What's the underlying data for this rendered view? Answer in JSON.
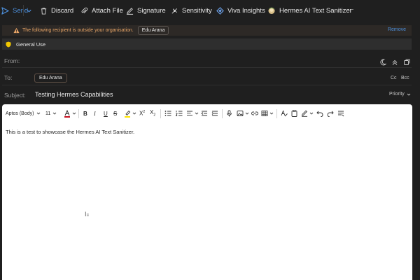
{
  "toolbar": {
    "send_label": "Send",
    "discard_label": "Discard",
    "attach_label": "Attach File",
    "signature_label": "Signature",
    "sensitivity_label": "Sensitivity",
    "viva_label": "Viva Insights",
    "hermes_label": "Hermes AI Text Sanitizer",
    "more_label": "···"
  },
  "warning": {
    "text": "The following recipient is outside your organisation.",
    "recipient": "Edu Arana",
    "remove_label": "Remove"
  },
  "sensitivity_banner": {
    "label": "General Use"
  },
  "fields": {
    "from_label": "From:",
    "to_label": "To:",
    "to_recipient": "Edu Arana",
    "cc_label": "Cc",
    "bcc_label": "Bcc",
    "subject_label": "Subject:",
    "subject_value": "Testing Hermes Capabilities",
    "priority_label": "Priority"
  },
  "format": {
    "font_name": "Aptos (Body)",
    "font_size": "11"
  },
  "body": {
    "text": "This is a test to showcase the Hermes AI Text Sanitizer."
  },
  "colors": {
    "accent": "#4c8ed9",
    "warning_text": "#e8a567",
    "font_color_red": "#c50f1f",
    "highlight_yellow": "#ffe500"
  }
}
